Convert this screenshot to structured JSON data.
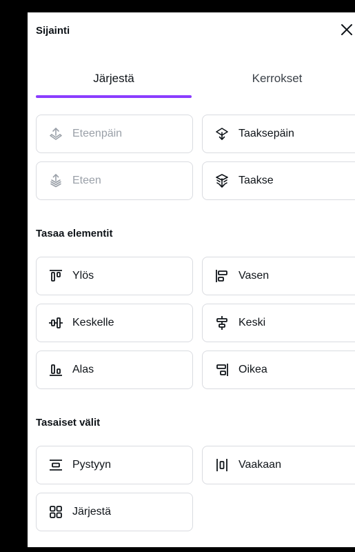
{
  "header": {
    "title": "Sijainti"
  },
  "tabs": {
    "arrange": "Järjestä",
    "layers": "Kerrokset"
  },
  "order": {
    "forward": "Eteenpäin",
    "backward": "Taaksepäin",
    "to_front": "Eteen",
    "to_back": "Taakse"
  },
  "align_section": {
    "title": "Tasaa elementit",
    "top": "Ylös",
    "left": "Vasen",
    "middle": "Keskelle",
    "center": "Keski",
    "bottom": "Alas",
    "right": "Oikea"
  },
  "spacing_section": {
    "title": "Tasaiset välit",
    "vertical": "Pystyyn",
    "horizontal": "Vaakaan",
    "tidy": "Järjestä"
  },
  "colors": {
    "accent": "#8b3dff",
    "border": "#d9dbe0",
    "text": "#0e1318",
    "disabled_text": "#9aa0a8"
  }
}
